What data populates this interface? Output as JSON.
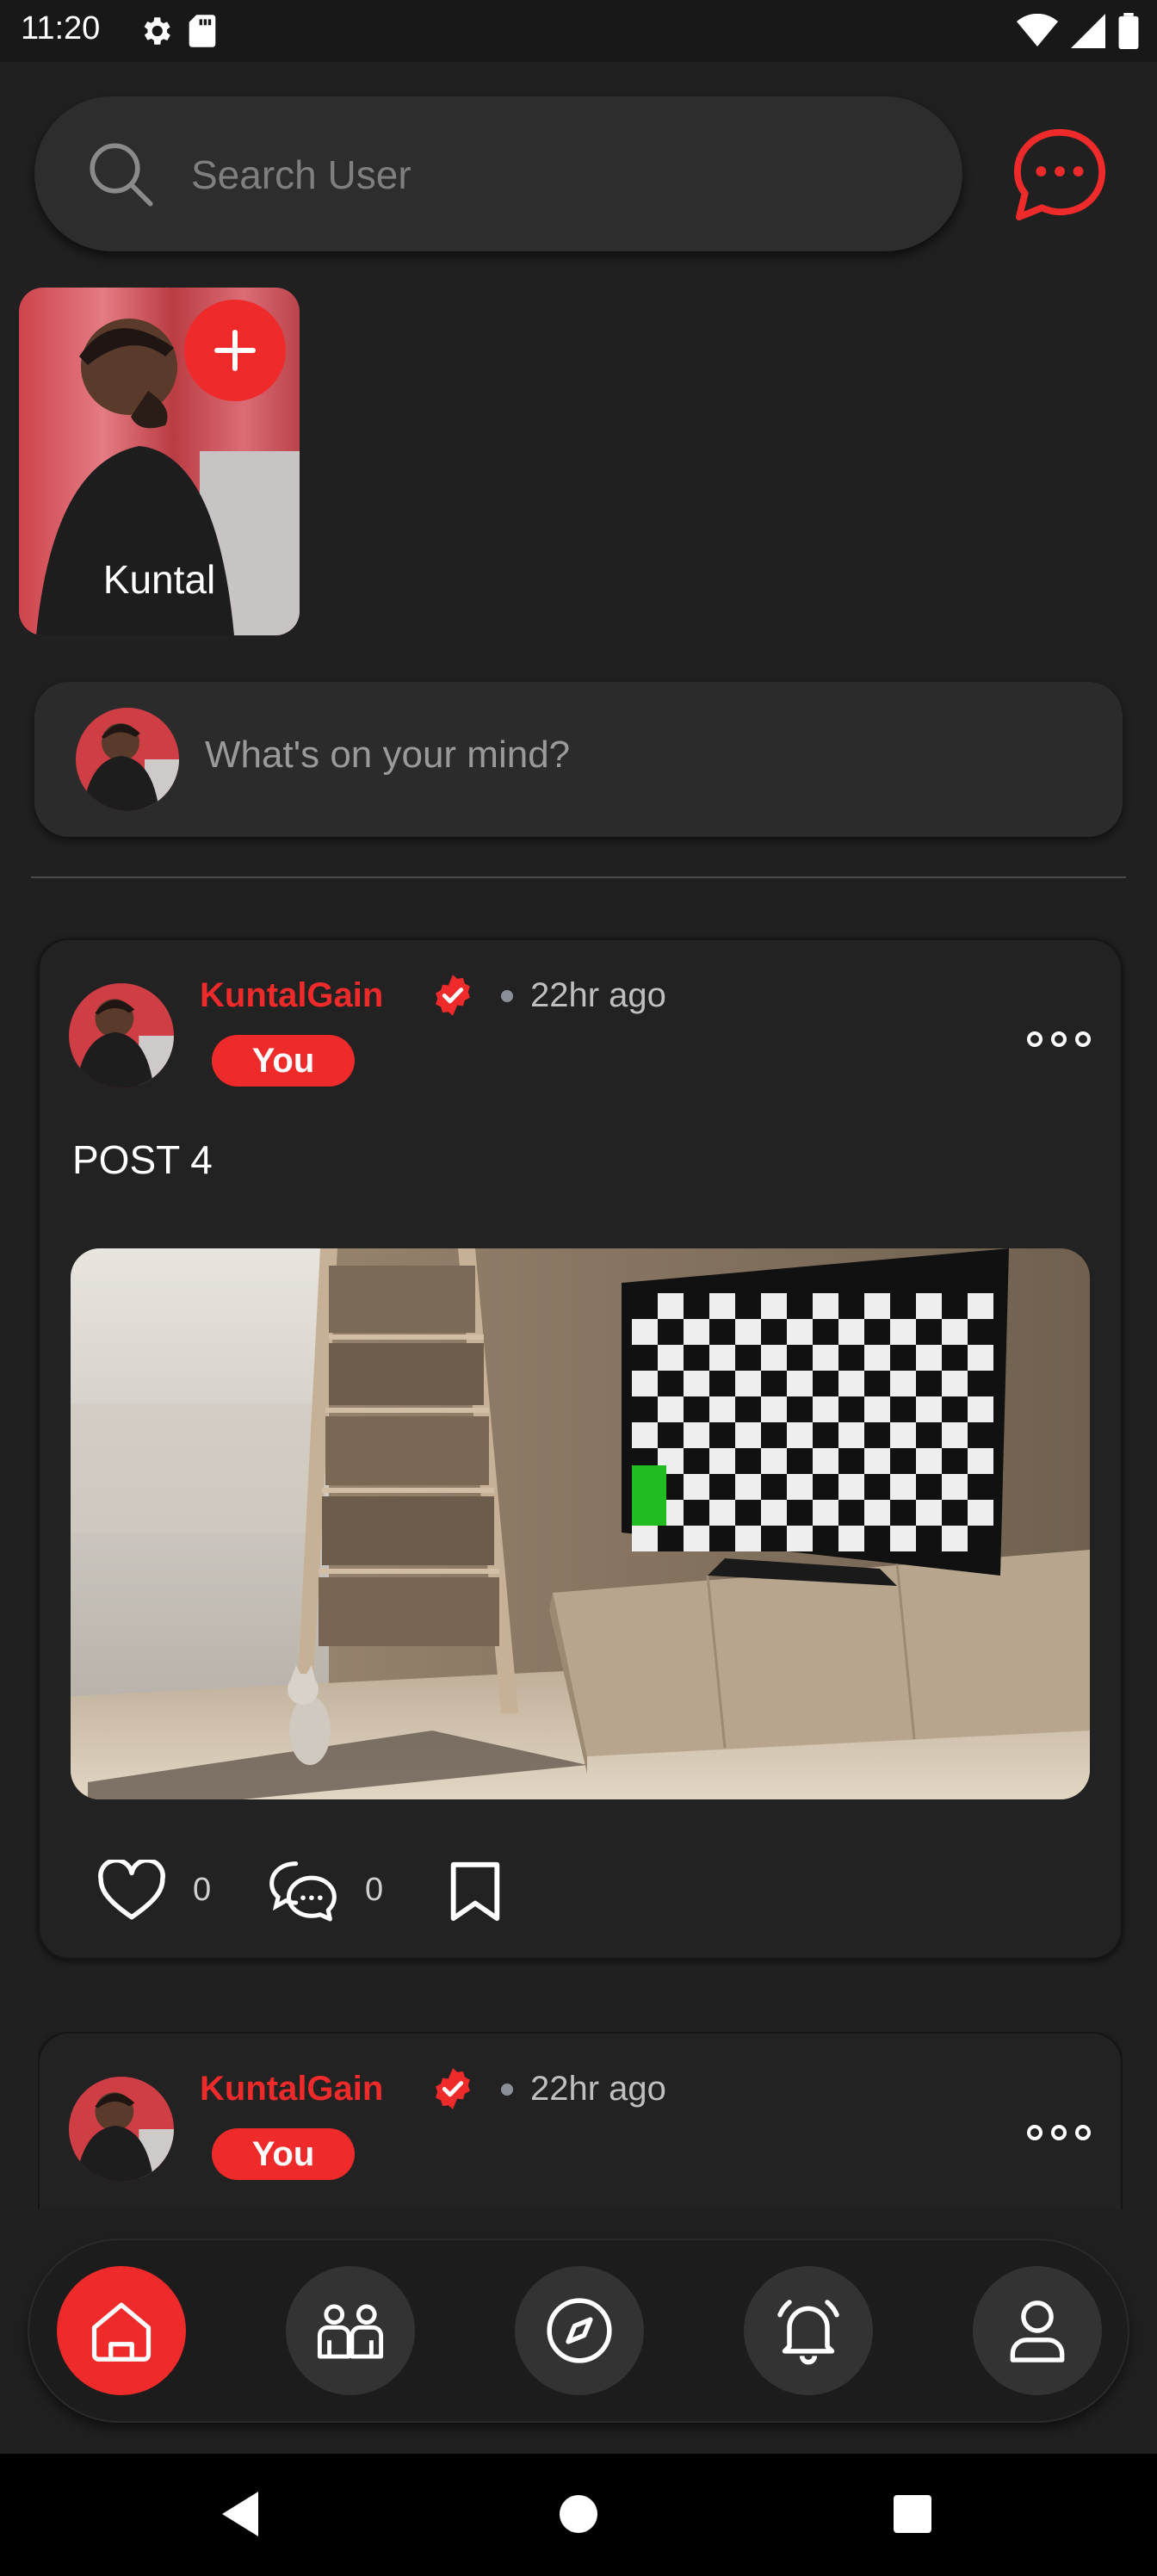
{
  "status_bar": {
    "time": "11:20"
  },
  "search": {
    "placeholder": "Search User"
  },
  "story": {
    "name": "Kuntal"
  },
  "composer": {
    "placeholder": "What's on your mind?"
  },
  "posts": [
    {
      "author": "KuntalGain",
      "time": "22hr ago",
      "badge": "You",
      "text": "POST 4",
      "likes": "0",
      "comments": "0"
    },
    {
      "author": "KuntalGain",
      "time": "22hr ago",
      "badge": "You"
    }
  ],
  "nav": {
    "items": [
      "home-icon",
      "friends-icon",
      "explore-icon",
      "notifications-icon",
      "profile-icon"
    ],
    "active": "home-icon"
  },
  "colors": {
    "accent": "#ee2a2a",
    "background": "#202020",
    "card": "#2b2b2b"
  }
}
